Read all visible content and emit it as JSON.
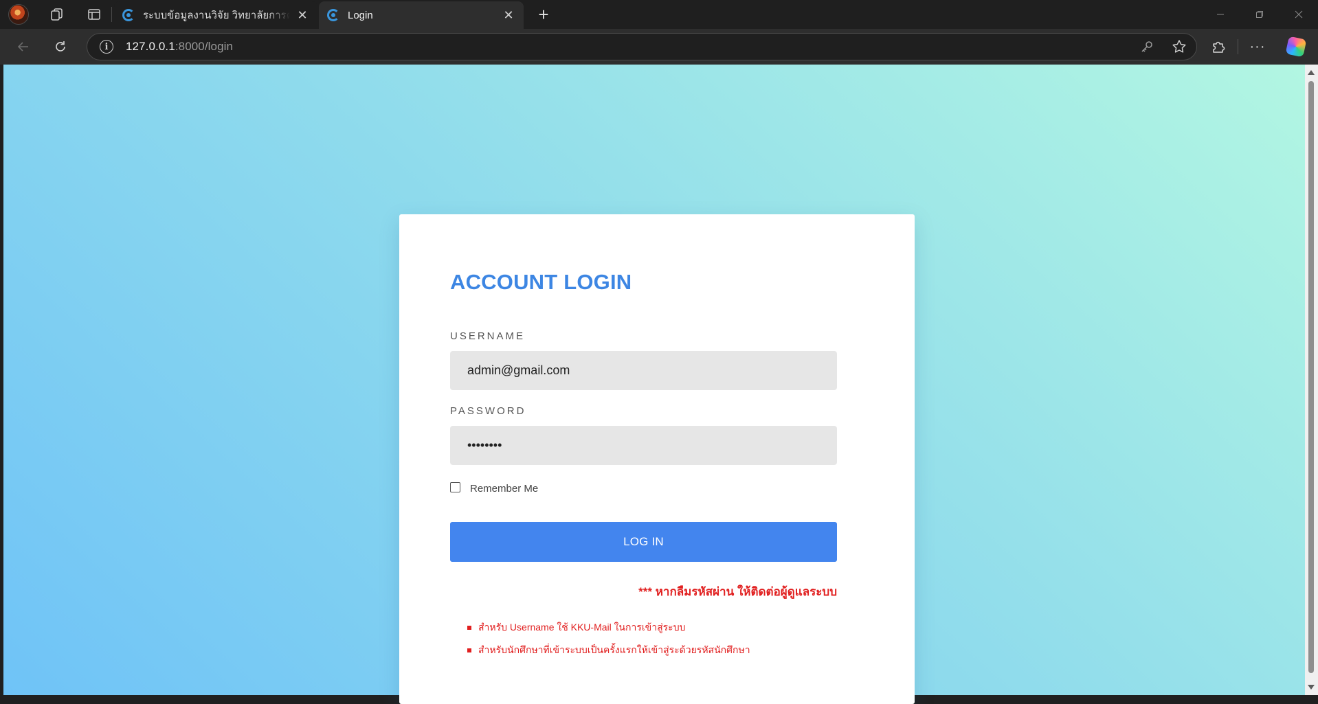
{
  "browser": {
    "tabs": [
      {
        "title": "ระบบข้อมูลงานวิจัย วิทยาลัยการคอมพิวเตอร์",
        "active": false
      },
      {
        "title": "Login",
        "active": true
      }
    ],
    "url_host": "127.0.0.1",
    "url_path": ":8000/login",
    "icons": {
      "profile": "profile-avatar",
      "workspaces": "workspaces-icon",
      "vertical_tabs": "vertical-tabs-icon",
      "new_tab": "+",
      "back": "back-arrow-icon",
      "refresh": "refresh-icon",
      "site_info": "i",
      "key": "key-icon",
      "favorite": "star-icon",
      "extensions": "puzzle-icon",
      "more": "···",
      "copilot": "copilot-icon"
    }
  },
  "login": {
    "title": "ACCOUNT LOGIN",
    "username_label": "USERNAME",
    "username_value": "admin@gmail.com",
    "password_label": "PASSWORD",
    "password_value": "••••••••",
    "remember_label": "Remember Me",
    "remember_checked": false,
    "button_label": "LOG IN",
    "forgot_note": "*** หากลืมรหัสผ่าน ให้ติดต่อผู้ดูแลระบบ",
    "notes": [
      "สำหรับ Username ใช้ KKU-Mail ในการเข้าสู่ระบบ",
      "สำหรับนักศึกษาที่เข้าระบบเป็นครั้งแรกให้เข้าสู่ระด้วยรหัสนักศึกษา"
    ]
  },
  "colors": {
    "accent": "#3d86e3",
    "button": "#4385ee",
    "warning": "#e11f1f",
    "bg_gradient_start": "#6fc3f7",
    "bg_gradient_end": "#b2f6e2"
  }
}
